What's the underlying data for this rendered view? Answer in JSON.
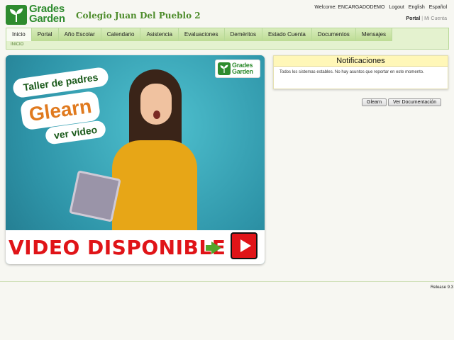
{
  "header": {
    "logo_line1": "Grades",
    "logo_line2": "Garden",
    "school_name": "Colegio Juan Del Pueblo 2",
    "welcome": "Welcome: ENCARGADODEMO",
    "logout": "Logout",
    "lang_en": "English",
    "lang_es": "Español",
    "portal": "Portal",
    "separator": "|",
    "my_account": "Mi Cuenta"
  },
  "nav": {
    "tabs": [
      "Inicio",
      "Portal",
      "Año Escolar",
      "Calendario",
      "Asistencia",
      "Evaluaciones",
      "Deméritos",
      "Estado Cuenta",
      "Documentos",
      "Mensajes"
    ],
    "active_tab": "Inicio",
    "breadcrumb": "INICIO"
  },
  "banner": {
    "bubble1": "Taller de padres",
    "bubble2": "Glearn",
    "bubble3": "ver video",
    "logo_line1": "Grades",
    "logo_line2": "Garden",
    "bottom_text": "VIDEO DISPONIBLE"
  },
  "notifications": {
    "title": "Notificaciones",
    "message": "Todos los sistemas estables. No hay asuntos que reportar en este momento."
  },
  "buttons": {
    "glearn": "Glearn",
    "docs": "Ver Documentación"
  },
  "footer": {
    "release": "Release 9.3"
  },
  "colors": {
    "accent_green": "#2e8b2e",
    "nav_bg": "#e4f2cf",
    "notif_header": "#fff7b8",
    "video_red": "#e01418"
  }
}
